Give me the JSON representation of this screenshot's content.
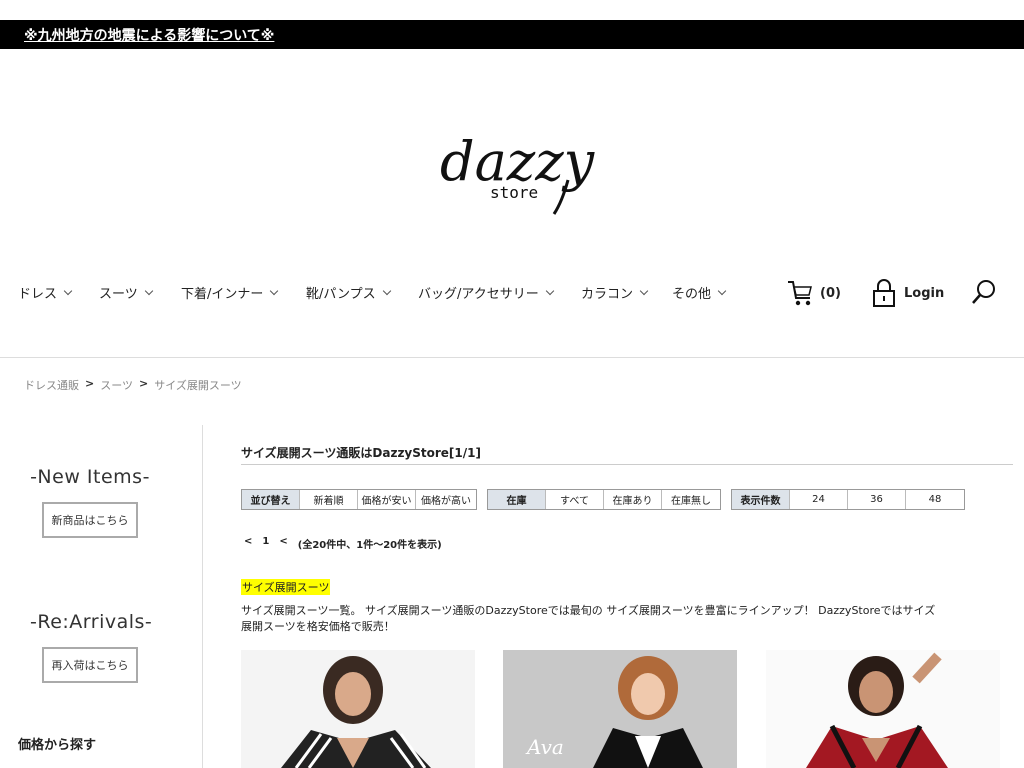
{
  "announcement": {
    "text": "※九州地方の地震による影響について※"
  },
  "logo": {
    "text": "dazzy",
    "sub": "store"
  },
  "nav": {
    "items": [
      {
        "label": "ドレス"
      },
      {
        "label": "スーツ"
      },
      {
        "label": "下着/インナー"
      },
      {
        "label": "靴/パンプス"
      },
      {
        "label": "バッグ/アクセサリー"
      },
      {
        "label": "カラコン"
      },
      {
        "label": "その他"
      }
    ],
    "cart_count": "(0)",
    "login_label": "Login"
  },
  "breadcrumb": {
    "items": [
      "ドレス通販",
      "スーツ",
      "サイズ展開スーツ"
    ],
    "separator": ">"
  },
  "sidebar": {
    "new_items": {
      "heading": "-New Items-",
      "button": "新商品はこちら"
    },
    "rearrivals": {
      "heading": "-Re:Arrivals-",
      "button": "再入荷はこちら"
    },
    "price_heading": "価格から探す"
  },
  "main": {
    "title": "サイズ展開スーツ通販はDazzyStore[1/1]",
    "sort": {
      "head": "並び替え",
      "options": [
        "新着順",
        "価格が安い",
        "価格が高い"
      ]
    },
    "stock": {
      "head": "在庫",
      "options": [
        "すべて",
        "在庫あり",
        "在庫無し"
      ]
    },
    "count": {
      "head": "表示件数",
      "options": [
        "24",
        "36",
        "48"
      ]
    },
    "pager": {
      "prev": "<",
      "page": "1",
      "next": "<",
      "summary": "(全20件中、1件〜20件を表示)"
    },
    "category_tag": "サイズ展開スーツ",
    "category_desc": "サイズ展開スーツ一覧。 サイズ展開スーツ通販のDazzyStoreでは最旬の サイズ展開スーツを豊富にラインアップ！ DazzyStoreではサイズ展開スーツを格安価格で販売！",
    "products": [
      {
        "image_label": ""
      },
      {
        "image_label": "Ava"
      },
      {
        "image_label": ""
      }
    ]
  }
}
